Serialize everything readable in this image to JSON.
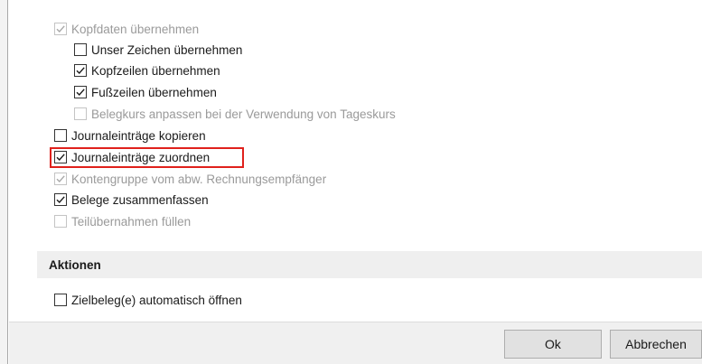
{
  "options": [
    {
      "key": "kopfdaten",
      "label": "Kopfdaten übernehmen",
      "checked": true,
      "disabled": true
    },
    {
      "key": "unser_zeichen",
      "label": "Unser Zeichen übernehmen",
      "checked": false,
      "disabled": false
    },
    {
      "key": "kopfzeilen",
      "label": "Kopfzeilen übernehmen",
      "checked": true,
      "disabled": false
    },
    {
      "key": "fusszeilen",
      "label": "Fußzeilen übernehmen",
      "checked": true,
      "disabled": false
    },
    {
      "key": "belegkurs",
      "label": "Belegkurs anpassen bei der Verwendung von Tageskurs",
      "checked": false,
      "disabled": true
    },
    {
      "key": "journal_kopieren",
      "label": "Journaleinträge kopieren",
      "checked": false,
      "disabled": false
    },
    {
      "key": "journal_zuordnen",
      "label": "Journaleinträge zuordnen",
      "checked": true,
      "disabled": false
    },
    {
      "key": "kontengruppe",
      "label": "Kontengruppe vom abw. Rechnungsempfänger",
      "checked": true,
      "disabled": true
    },
    {
      "key": "belege_zusammen",
      "label": "Belege zusammenfassen",
      "checked": true,
      "disabled": false
    },
    {
      "key": "teiluebernahmen",
      "label": "Teilübernahmen füllen",
      "checked": false,
      "disabled": true
    }
  ],
  "actions_section": {
    "title": "Aktionen",
    "open_target": {
      "label": "Zielbeleg(e) automatisch öffnen",
      "checked": false
    }
  },
  "footer": {
    "ok_label": "Ok",
    "cancel_label": "Abbrechen"
  },
  "highlight_color": "#e0211c"
}
